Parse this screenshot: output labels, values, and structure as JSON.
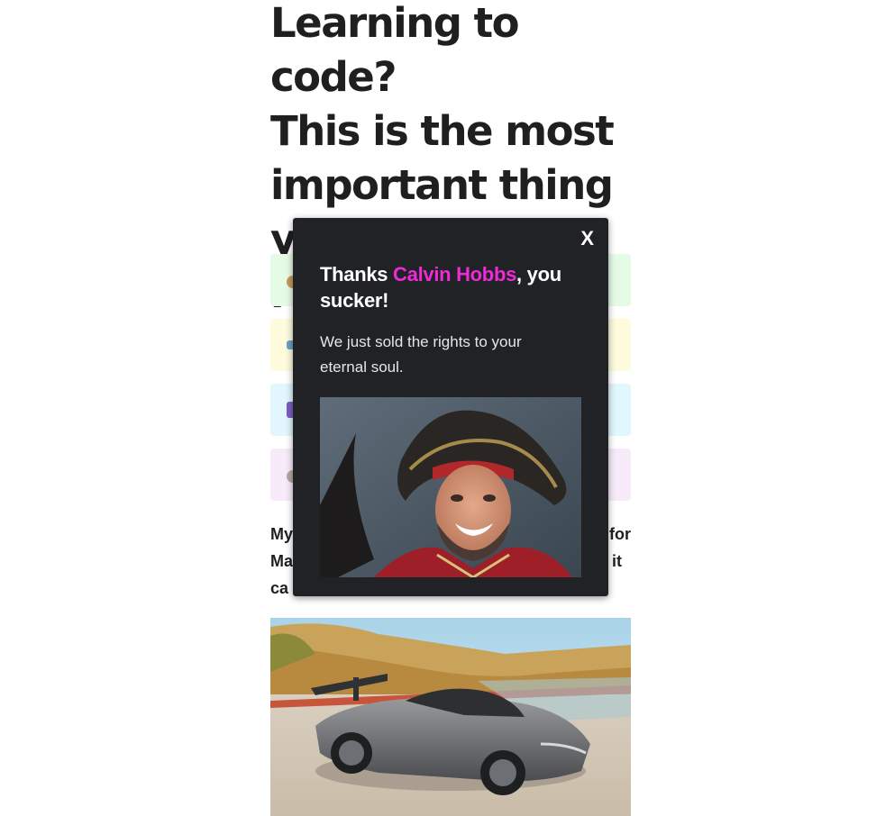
{
  "article": {
    "headline": "Learning to code?\nThis is the most\nimportant thing\nyou will ever read!",
    "paragraph_fragments": {
      "line1_start": "My",
      "line1_end": "for",
      "line2_start": "Ma",
      "line2_end": "it",
      "line3_start": "ca"
    }
  },
  "popup": {
    "close_label": "X",
    "title_prefix": "Thanks ",
    "user_name": "Calvin Hobbs",
    "title_suffix": ", you sucker!",
    "message": "We just sold the rights to your eternal soul.",
    "image_alt": "pirate-captain-image"
  },
  "colors": {
    "popup_bg": "#202226",
    "name_accent": "#ee2bd6",
    "card_green": "#e6fbe6",
    "card_yellow": "#fdfbdc",
    "card_blue": "#e1f6fd",
    "card_purple": "#f7ebfa"
  }
}
